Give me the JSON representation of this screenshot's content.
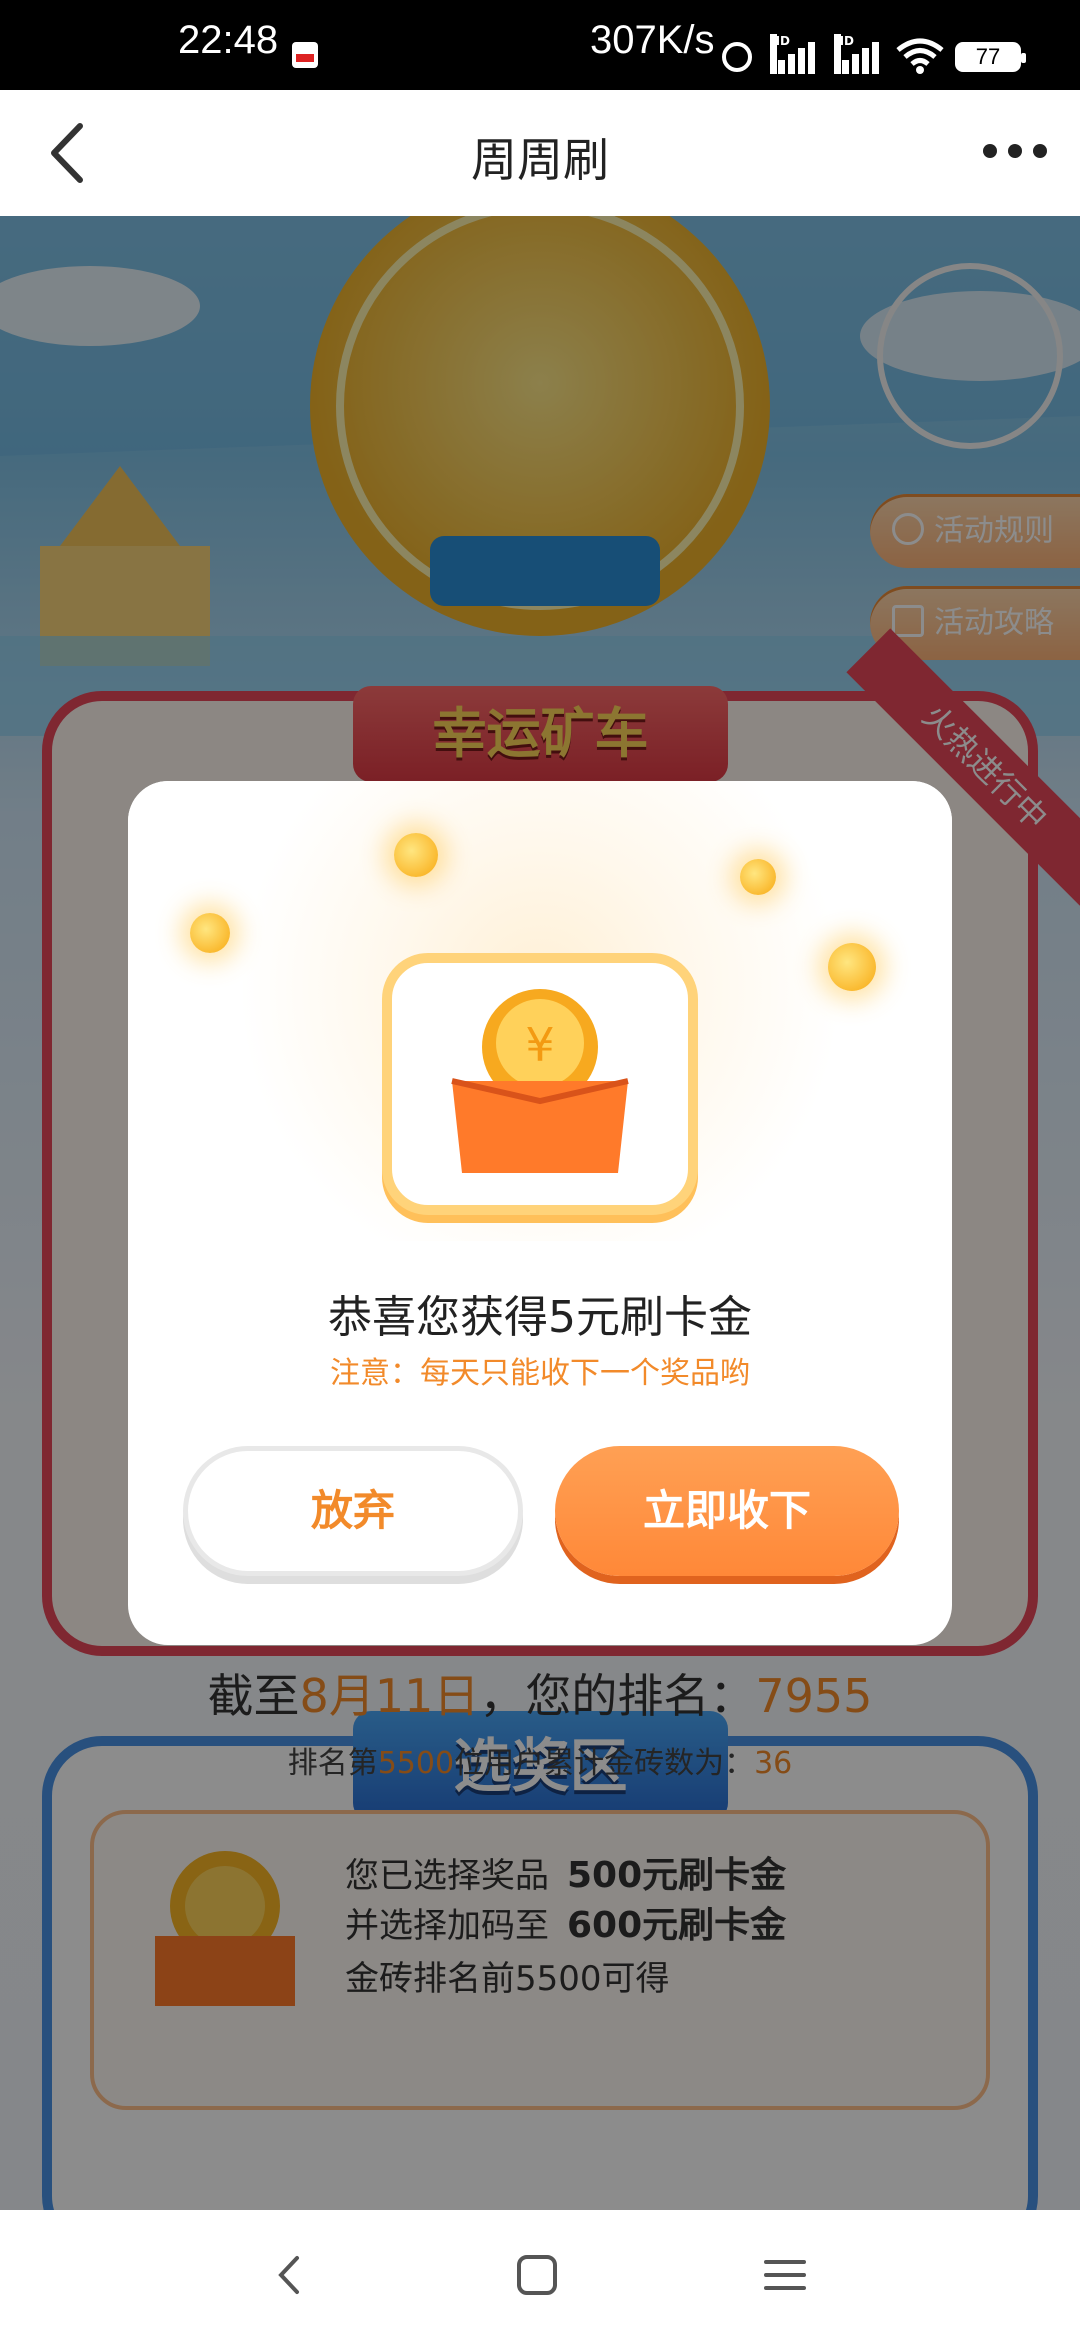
{
  "status_bar": {
    "time": "22:48",
    "speed": "307K/s",
    "battery": "77",
    "hd_label": "HD"
  },
  "navbar": {
    "title": "周周刷"
  },
  "banner": {
    "rules_label": "活动规则",
    "guide_label": "活动攻略"
  },
  "lucky_section": {
    "title": "幸运矿车",
    "ribbon": "火热进行中"
  },
  "modal": {
    "congrats_text": "恭喜您获得5元刷卡金",
    "note_text": "注意：每天只能收下一个奖品哟",
    "giveup_label": "放弃",
    "accept_label": "立即收下"
  },
  "prize_section": {
    "title": "选奖区",
    "rank_prefix": "截至",
    "rank_date": "8月11日",
    "rank_mid": "，您的排名：",
    "rank_value": "7955",
    "sub_prefix": "排名第",
    "sub_rank": "5500",
    "sub_mid": "位用户累计金砖数为：",
    "sub_value": "36",
    "selected_label": "您已选择奖品",
    "selected_prize": "500元刷卡金",
    "boost_label": "并选择加码至",
    "boost_prize": "600元刷卡金",
    "condition": "金砖排名前5500可得"
  },
  "colors": {
    "accent_orange": "#f28a2a",
    "accept_button": "#ff8838",
    "lucky_red": "#e8485a",
    "prize_blue": "#4a93e6"
  }
}
